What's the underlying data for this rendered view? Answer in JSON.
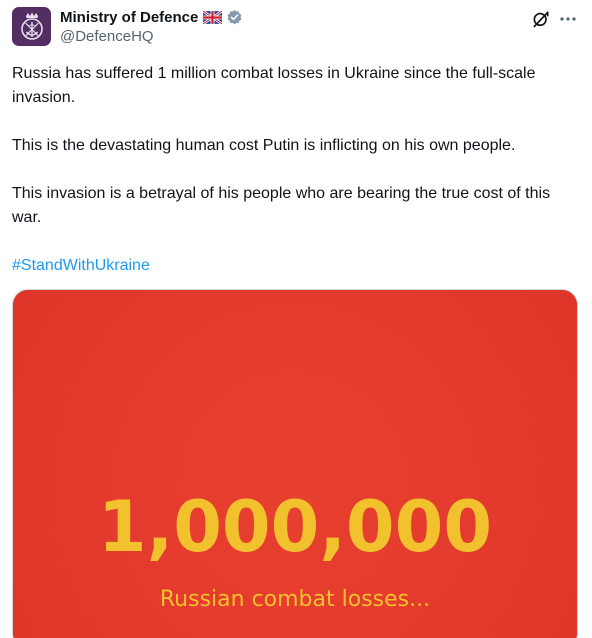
{
  "author": {
    "display_name": "Ministry of Defence",
    "handle": "@DefenceHQ",
    "badges": [
      "uk-flag-icon",
      "verified-icon"
    ]
  },
  "tweet": {
    "paragraphs": [
      "Russia has suffered 1 million combat losses in Ukraine since the full-scale invasion.",
      "This is the devastating human cost Putin is inflicting on his own people.",
      "This invasion is a betrayal of his people who are bearing the true cost of this war."
    ],
    "hashtag": "#StandWithUkraine"
  },
  "media": {
    "headline_number": "1,000,000",
    "caption": "Russian combat losses..."
  },
  "colors": {
    "avatar_bg": "#532e63",
    "link": "#1d9bf0",
    "media_bg": "#e53c2f",
    "media_text": "#f2c12e",
    "secondary_text": "#536471"
  },
  "icons": {
    "grok": "grok-icon",
    "more": "more-dots-icon"
  }
}
